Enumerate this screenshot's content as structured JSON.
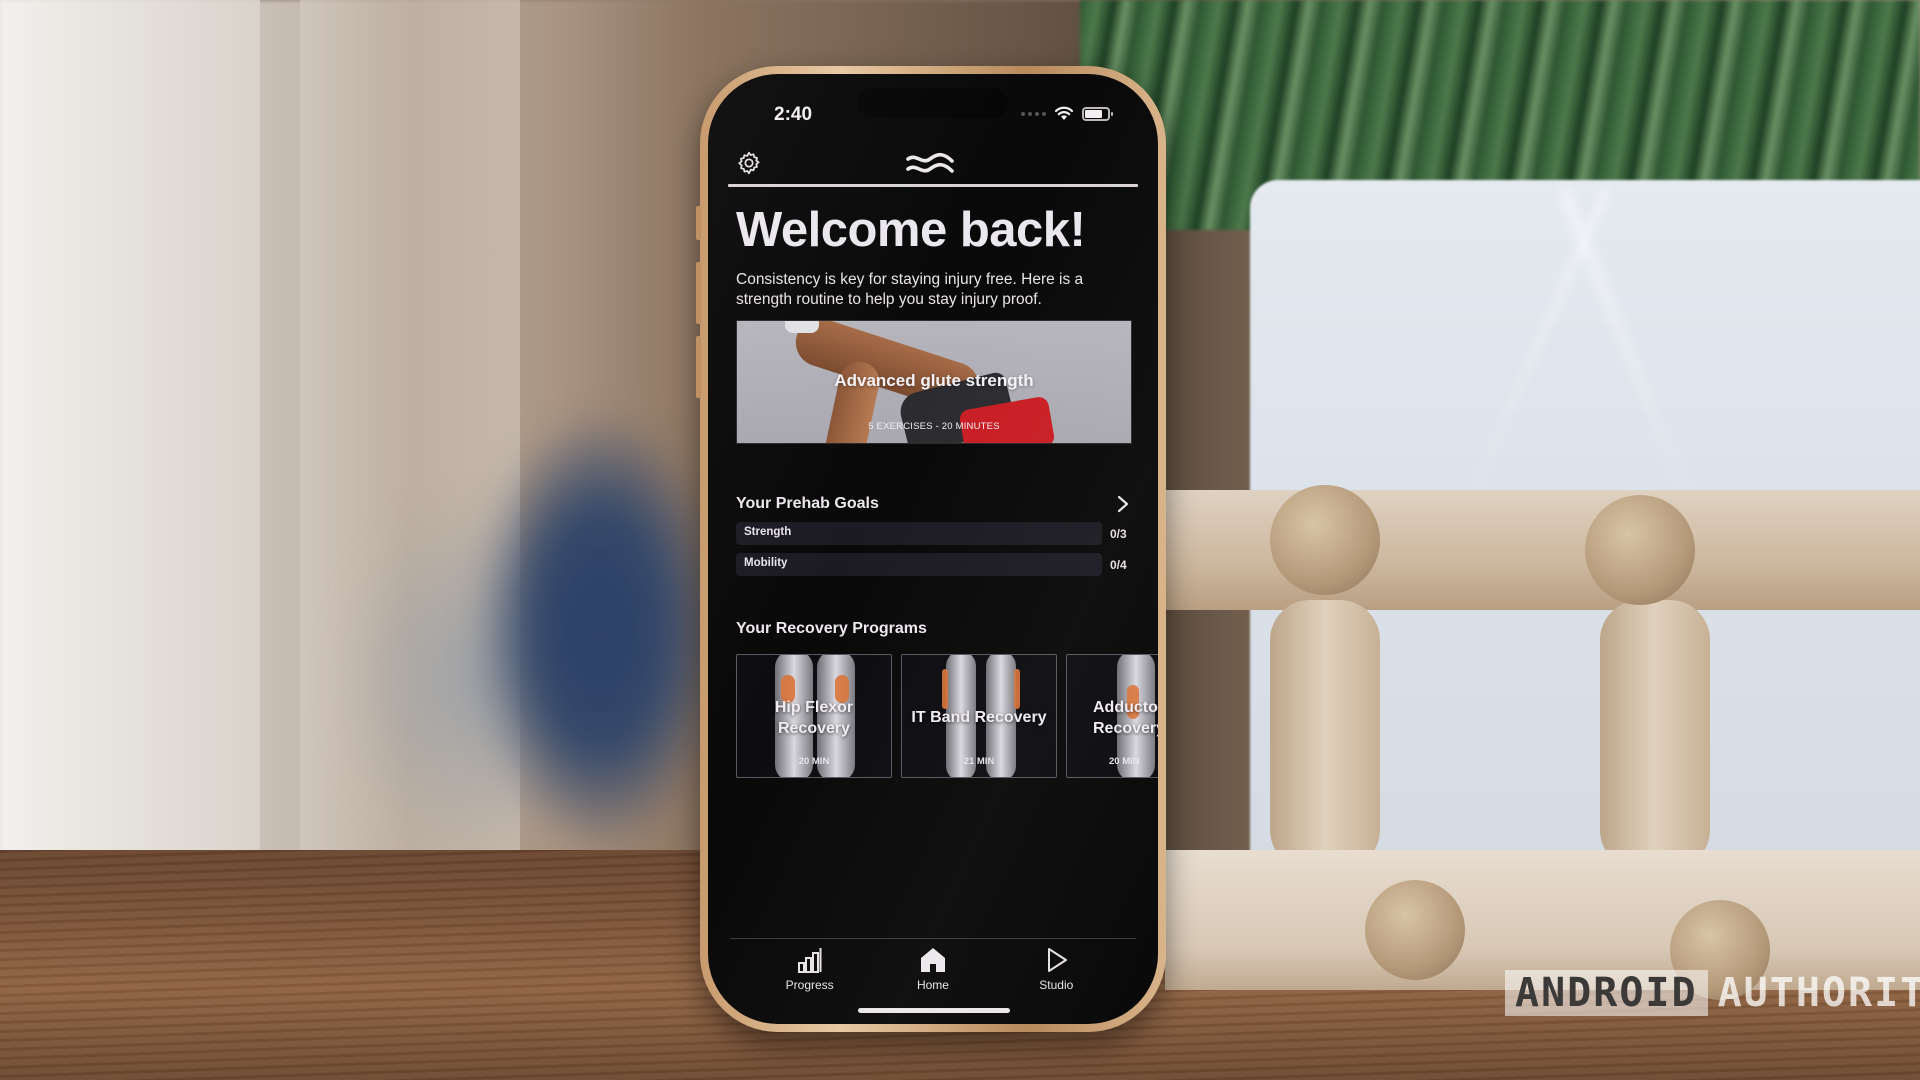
{
  "status_bar": {
    "time": "2:40",
    "wifi_icon": "wifi-icon",
    "battery_icon": "battery-icon",
    "battery_level": 0.7
  },
  "header": {
    "settings_icon": "gear-icon",
    "logo_icon": "wave-logo-icon"
  },
  "welcome": {
    "title": "Welcome back!",
    "intro": "Consistency is key for staying injury free. Here is a strength routine to help you stay injury proof."
  },
  "featured_workout": {
    "title": "Advanced glute strength",
    "subtitle": "5 EXERCISES - 20 MINUTES"
  },
  "prehab_goals": {
    "title": "Your Prehab Goals",
    "chevron_icon": "chevron-right-icon",
    "goals": [
      {
        "label": "Strength",
        "count": "0/3",
        "progress": 0
      },
      {
        "label": "Mobility",
        "count": "0/4",
        "progress": 0
      }
    ]
  },
  "recovery_programs": {
    "title": "Your Recovery Programs",
    "programs": [
      {
        "title": "Hip Flexor\nRecovery",
        "duration": "20 MIN"
      },
      {
        "title": "IT Band Recovery",
        "duration": "21 MIN"
      },
      {
        "title": "Adductor\nRecovery",
        "duration": "20 MIN"
      }
    ]
  },
  "tab_bar": {
    "tabs": [
      {
        "label": "Progress",
        "icon": "bar-chart-icon"
      },
      {
        "label": "Home",
        "icon": "home-icon",
        "active": true
      },
      {
        "label": "Studio",
        "icon": "play-icon"
      }
    ]
  },
  "watermark": {
    "part1": "ANDROID",
    "part2": "AUTHORITY"
  },
  "colors": {
    "screen_bg": "#0a0909",
    "text_primary": "#ebe7ee",
    "goal_bar_bg": "#1c1b23",
    "program_highlight": "#d9743a",
    "phone_frame": "#c89b6e"
  }
}
